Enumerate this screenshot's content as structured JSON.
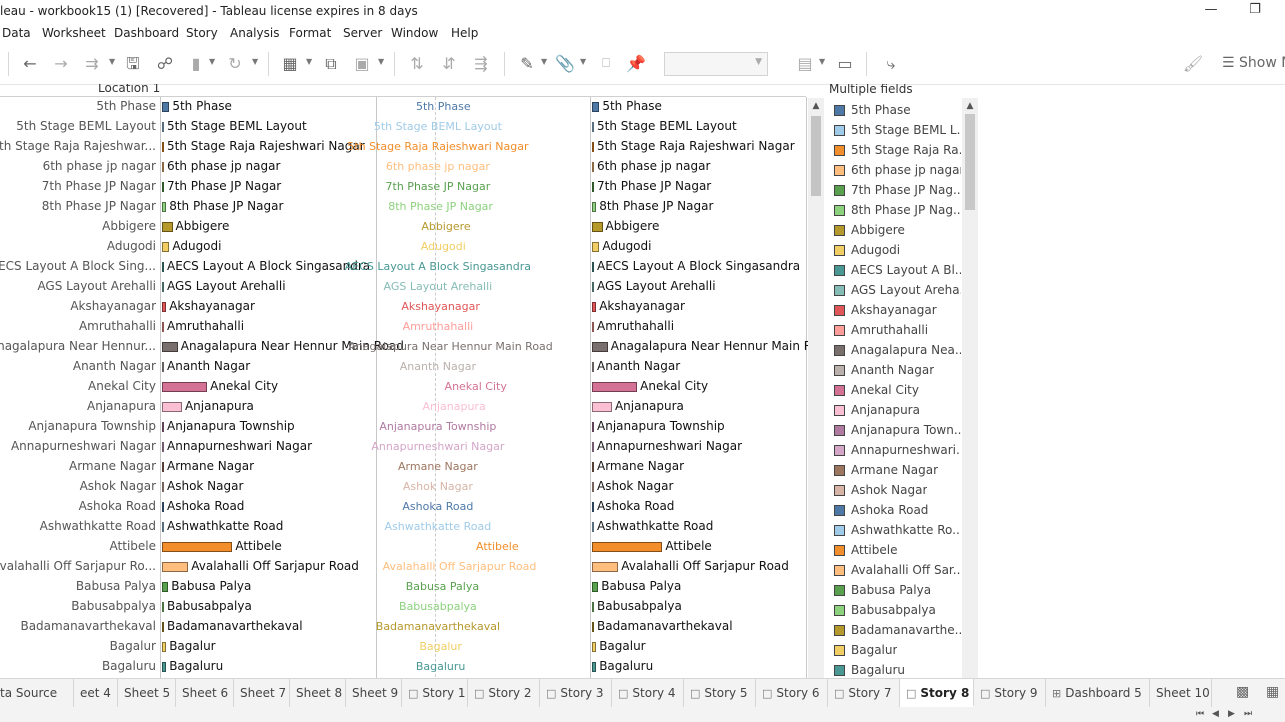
{
  "window": {
    "title": "leau - workbook15 (1) [Recovered] - Tableau license expires in 8 days",
    "min_icon": "minimize-icon",
    "restore_icon": "restore-icon"
  },
  "menu": [
    "Data",
    "Worksheet",
    "Dashboard",
    "Story",
    "Analysis",
    "Format",
    "Server",
    "Window",
    "Help"
  ],
  "toolbar": {
    "show_me_label": "Show M",
    "icons": [
      "back-icon",
      "forward-icon",
      "redo-icon",
      "save-icon",
      "new-datasource-icon",
      "pause-updates-icon",
      "refresh-icon",
      "new-worksheet-icon",
      "duplicate-sheet-icon",
      "clear-sheet-icon",
      "swap-icon",
      "sort-ascending-icon",
      "sort-descending-icon",
      "highlight-icon",
      "group-icon",
      "labels-icon",
      "pin-icon",
      "fit-dropdown",
      "show-cards-icon",
      "presentation-icon",
      "share-icon",
      "format-brush-icon",
      "show-me-icon"
    ]
  },
  "viz": {
    "row_header": "Location 1",
    "rows": [
      {
        "label": "5th Phase",
        "full": "5th Phase",
        "value": 7,
        "color": "#4e79a7"
      },
      {
        "label": "5th Stage BEML Layout",
        "full": "5th Stage BEML Layout",
        "value": 1,
        "color": "#a0cbe8"
      },
      {
        "label": "5th Stage Raja Rajeshwar...",
        "full": "5th Stage Raja Rajeshwari Nagar",
        "value": 1,
        "color": "#f28e2b"
      },
      {
        "label": "6th phase jp nagar",
        "full": "6th phase jp nagar",
        "value": 1,
        "color": "#ffbe7d"
      },
      {
        "label": "7th Phase JP Nagar",
        "full": "7th Phase JP Nagar",
        "value": 1,
        "color": "#59a14f"
      },
      {
        "label": "8th Phase JP Nagar",
        "full": "8th Phase JP Nagar",
        "value": 4,
        "color": "#8cd17d"
      },
      {
        "label": "Abbigere",
        "full": "Abbigere",
        "value": 10,
        "color": "#b6992d"
      },
      {
        "label": "Adugodi",
        "full": "Adugodi",
        "value": 7,
        "color": "#f1ce63"
      },
      {
        "label": "AECS Layout A Block Sing...",
        "full": "AECS Layout A Block Singasandra",
        "value": 1,
        "color": "#499894"
      },
      {
        "label": "AGS Layout Arehalli",
        "full": "AGS Layout Arehalli",
        "value": 1,
        "color": "#86bcb6"
      },
      {
        "label": "Akshayanagar",
        "full": "Akshayanagar",
        "value": 4,
        "color": "#e15759"
      },
      {
        "label": "Amruthahalli",
        "full": "Amruthahalli",
        "value": 1,
        "color": "#ff9d9a"
      },
      {
        "label": "Anagalapura Near Hennur...",
        "full": "Anagalapura Near Hennur Main Road",
        "value": 15,
        "color": "#79706e"
      },
      {
        "label": "Ananth Nagar",
        "full": "Ananth Nagar",
        "value": 1,
        "color": "#bab0ac"
      },
      {
        "label": "Anekal City",
        "full": "Anekal City",
        "value": 43,
        "color": "#d37295"
      },
      {
        "label": "Anjanapura",
        "full": "Anjanapura",
        "value": 19,
        "color": "#fabfd2"
      },
      {
        "label": "Anjanapura Township",
        "full": "Anjanapura Township",
        "value": 1,
        "color": "#b07aa1"
      },
      {
        "label": "Annapurneshwari Nagar",
        "full": "Annapurneshwari Nagar",
        "value": 1,
        "color": "#d4a6c8"
      },
      {
        "label": "Armane Nagar",
        "full": "Armane Nagar",
        "value": 1,
        "color": "#9d7660"
      },
      {
        "label": "Ashok Nagar",
        "full": "Ashok Nagar",
        "value": 1,
        "color": "#d7b5a6"
      },
      {
        "label": "Ashoka Road",
        "full": "Ashoka Road",
        "value": 1,
        "color": "#4e79a7"
      },
      {
        "label": "Ashwathkatte Road",
        "full": "Ashwathkatte Road",
        "value": 1,
        "color": "#a0cbe8"
      },
      {
        "label": "Attibele",
        "full": "Attibele",
        "value": 67,
        "color": "#f28e2b"
      },
      {
        "label": "Avalahalli Off Sarjapur Ro...",
        "full": "Avalahalli Off Sarjapur Road",
        "value": 25,
        "color": "#ffbe7d"
      },
      {
        "label": "Babusa Palya",
        "full": "Babusa Palya",
        "value": 6,
        "color": "#59a14f"
      },
      {
        "label": "Babusabpalya",
        "full": "Babusabpalya",
        "value": 1,
        "color": "#8cd17d"
      },
      {
        "label": "Badamanavarthekaval",
        "full": "Badamanavarthekaval",
        "value": 1,
        "color": "#b6992d"
      },
      {
        "label": "Bagalur",
        "full": "Bagalur",
        "value": 4,
        "color": "#f1ce63"
      },
      {
        "label": "Bagaluru",
        "full": "Bagaluru",
        "value": 4,
        "color": "#499894"
      }
    ]
  },
  "legend": {
    "title": "Multiple fields",
    "items": [
      {
        "label": "5th Phase",
        "color": "#4e79a7"
      },
      {
        "label": "5th Stage BEML L...",
        "color": "#a0cbe8"
      },
      {
        "label": "5th Stage Raja Ra...",
        "color": "#f28e2b"
      },
      {
        "label": "6th phase jp nagar",
        "color": "#ffbe7d"
      },
      {
        "label": "7th Phase JP Nag...",
        "color": "#59a14f"
      },
      {
        "label": "8th Phase JP Nag...",
        "color": "#8cd17d"
      },
      {
        "label": "Abbigere",
        "color": "#b6992d"
      },
      {
        "label": "Adugodi",
        "color": "#f1ce63"
      },
      {
        "label": "AECS Layout A Bl...",
        "color": "#499894"
      },
      {
        "label": "AGS Layout Areha...",
        "color": "#86bcb6"
      },
      {
        "label": "Akshayanagar",
        "color": "#e15759"
      },
      {
        "label": "Amruthahalli",
        "color": "#ff9d9a"
      },
      {
        "label": "Anagalapura Nea...",
        "color": "#79706e"
      },
      {
        "label": "Ananth Nagar",
        "color": "#bab0ac"
      },
      {
        "label": "Anekal City",
        "color": "#d37295"
      },
      {
        "label": "Anjanapura",
        "color": "#fabfd2"
      },
      {
        "label": "Anjanapura Town...",
        "color": "#b07aa1"
      },
      {
        "label": "Annapurneshwari...",
        "color": "#d4a6c8"
      },
      {
        "label": "Armane Nagar",
        "color": "#9d7660"
      },
      {
        "label": "Ashok Nagar",
        "color": "#d7b5a6"
      },
      {
        "label": "Ashoka Road",
        "color": "#4e79a7"
      },
      {
        "label": "Ashwathkatte Ro...",
        "color": "#a0cbe8"
      },
      {
        "label": "Attibele",
        "color": "#f28e2b"
      },
      {
        "label": "Avalahalli Off Sar...",
        "color": "#ffbe7d"
      },
      {
        "label": "Babusa Palya",
        "color": "#59a14f"
      },
      {
        "label": "Babusabpalya",
        "color": "#8cd17d"
      },
      {
        "label": "Badamanavarthe...",
        "color": "#b6992d"
      },
      {
        "label": "Bagalur",
        "color": "#f1ce63"
      },
      {
        "label": "Bagaluru",
        "color": "#499894"
      }
    ]
  },
  "tabs": [
    {
      "label": "ta Source",
      "kind": "datasource"
    },
    {
      "label": "eet 4",
      "kind": "sheet"
    },
    {
      "label": "Sheet 5",
      "kind": "sheet"
    },
    {
      "label": "Sheet 6",
      "kind": "sheet"
    },
    {
      "label": "Sheet 7",
      "kind": "sheet"
    },
    {
      "label": "Sheet 8",
      "kind": "sheet"
    },
    {
      "label": "Sheet 9",
      "kind": "sheet"
    },
    {
      "label": "Story 1",
      "kind": "story"
    },
    {
      "label": "Story 2",
      "kind": "story"
    },
    {
      "label": "Story 3",
      "kind": "story"
    },
    {
      "label": "Story 4",
      "kind": "story"
    },
    {
      "label": "Story 5",
      "kind": "story"
    },
    {
      "label": "Story 6",
      "kind": "story"
    },
    {
      "label": "Story 7",
      "kind": "story"
    },
    {
      "label": "Story 8",
      "kind": "story",
      "active": true
    },
    {
      "label": "Story 9",
      "kind": "story"
    },
    {
      "label": "Dashboard 5",
      "kind": "dashboard"
    },
    {
      "label": "Sheet 10",
      "kind": "sheet"
    }
  ]
}
